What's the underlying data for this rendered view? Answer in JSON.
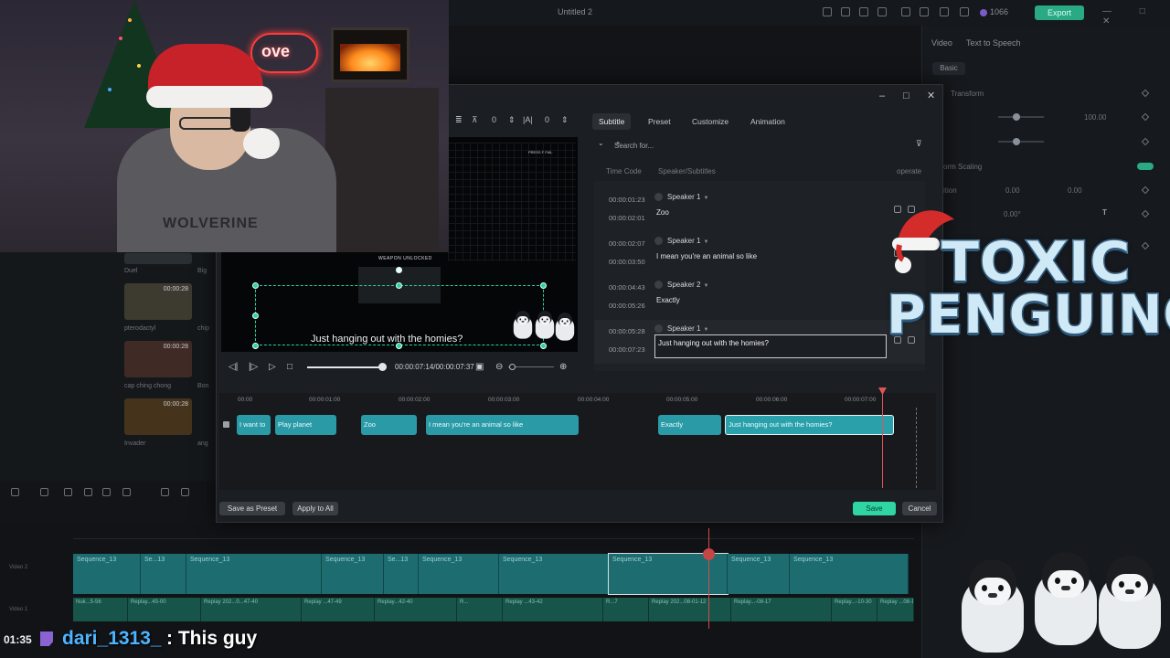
{
  "app": {
    "title": "Untitled 2",
    "credits": "1066",
    "export_label": "Export",
    "window_controls": "— □ ✕"
  },
  "right_panel": {
    "tabs": [
      "Video",
      "Text to Speech"
    ],
    "basic_label": "Basic",
    "transform_label": "Transform",
    "scale_value": "100.00",
    "uniform_scaling_label": "Uniform Scaling",
    "position_label": "Position",
    "pos_x": "0.00",
    "pos_y": "0.00",
    "rotate_value": "0.00°",
    "scaling_label": "orm Scaling",
    "partial_label": "ition"
  },
  "media": {
    "items": [
      {
        "label": "Duel",
        "duration": ""
      },
      {
        "label": "pterodactyl",
        "duration": "00:00:28"
      },
      {
        "label": "cap ching chong",
        "duration": "00:00:28"
      },
      {
        "label": "Invader",
        "duration": "00:00:28"
      }
    ],
    "right_labels": [
      "Big",
      "chip",
      "Bon",
      "ang"
    ]
  },
  "dialog": {
    "preview_tools": {
      "spacing_value": "0",
      "line_value": "0"
    },
    "weapon_text": "WEAPON UNLOCKED",
    "preview_subtitle": "Just hanging out with the homies?",
    "time_display": "00:00:07:14/00:00:07:37",
    "tabs": [
      {
        "label": "Subtitle",
        "active": true
      },
      {
        "label": "Preset",
        "active": false
      },
      {
        "label": "Customize",
        "active": false
      },
      {
        "label": "Animation",
        "active": false
      }
    ],
    "search_placeholder": "Search for...",
    "columns": {
      "time": "Time Code",
      "speaker": "Speaker/Subtitles",
      "operate": "operate"
    },
    "subtitles": [
      {
        "start": "00:00:01:23",
        "end": "00:00:02:01",
        "speaker": "Speaker 1",
        "text": "Zoo"
      },
      {
        "start": "00:00:02:07",
        "end": "00:00:03:50",
        "speaker": "Speaker 1",
        "text": "I mean you're an animal so like"
      },
      {
        "start": "00:00:04:43",
        "end": "00:00:05:26",
        "speaker": "Speaker 2",
        "text": "Exactly"
      },
      {
        "start": "00:00:05:28",
        "end": "00:00:07:23",
        "speaker": "Speaker 1",
        "text": "Just hanging out with the homies?"
      }
    ],
    "ruler": [
      "00:00",
      "00:00:01:00",
      "00:00:02:00",
      "00:00:03:00",
      "00:00:04:00",
      "00:00:05:00",
      "00:00:06:00",
      "00:00:07:00"
    ],
    "clips": [
      "I want to",
      "Play planet",
      "Zoo",
      "I mean you're an animal so like",
      "Exactly",
      "Just hanging out with the homies?"
    ],
    "buttons": {
      "save_preset": "Save as Preset",
      "apply_all": "Apply to All",
      "save": "Save",
      "cancel": "Cancel"
    }
  },
  "timeline": {
    "sequences": [
      "Sequence_13",
      "Se...13",
      "Sequence_13",
      "Sequence_13",
      "Se...13",
      "Sequence_13",
      "Sequence_13",
      "Sequence_13",
      "Sequence_13",
      "Sequence_13"
    ],
    "audio": [
      "Nuk...5-56",
      "Replay...45-00",
      "Replay 202...0...47-40",
      "Replay ...47-49",
      "Replay...42-40",
      "R...",
      "Replay ...43-42",
      "R...7",
      "Replay 202...08-01-12",
      "Replay...-08-17",
      "Replay...-10-30",
      "Replay ...08-17"
    ]
  },
  "webcam": {
    "neon_text": "ove",
    "shirt_text": "WOLVERINE"
  },
  "logo": {
    "line1": "TOXIC",
    "line2": "PENGUINO"
  },
  "chat": {
    "time": "01:35",
    "user": "dari_1313_",
    "message": ": This guy"
  },
  "colors": {
    "accent": "#2fd6a4",
    "clip": "#2a9aa6",
    "playhead": "#e05454",
    "chat_user": "#4db5ff"
  }
}
